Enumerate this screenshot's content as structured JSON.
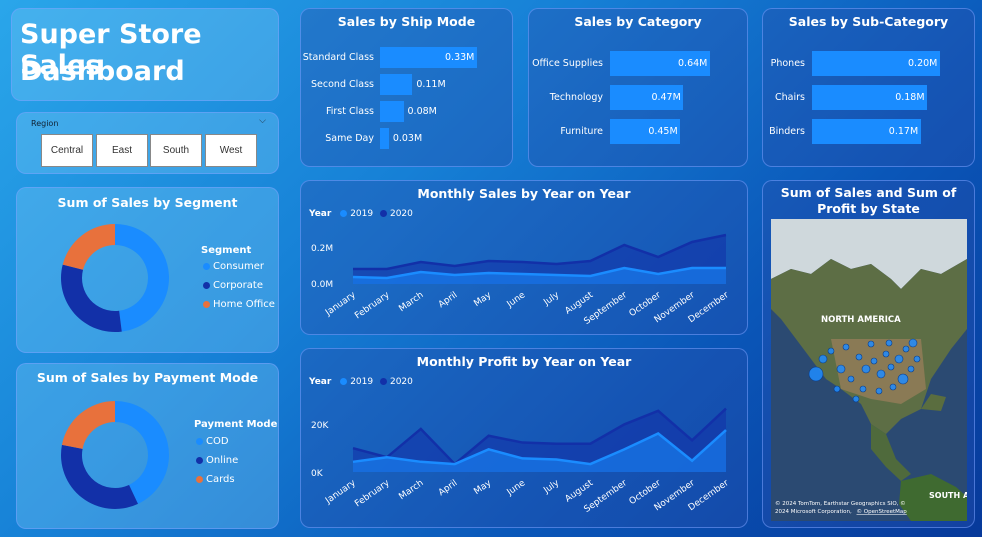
{
  "title": {
    "line1": "Super Store Sales",
    "line2": "Dashboard"
  },
  "region_slicer": {
    "label": "Region",
    "options": [
      "Central",
      "East",
      "South",
      "West"
    ]
  },
  "ship_mode": {
    "title": "Sales by Ship Mode",
    "items": [
      {
        "label": "Standard Class",
        "value": 0.33,
        "display": "0.33M"
      },
      {
        "label": "Second Class",
        "value": 0.11,
        "display": "0.11M"
      },
      {
        "label": "First Class",
        "value": 0.08,
        "display": "0.08M"
      },
      {
        "label": "Same Day",
        "value": 0.03,
        "display": "0.03M"
      }
    ]
  },
  "category": {
    "title": "Sales by Category",
    "items": [
      {
        "label": "Office Supplies",
        "value": 0.64,
        "display": "0.64M"
      },
      {
        "label": "Technology",
        "value": 0.47,
        "display": "0.47M"
      },
      {
        "label": "Furniture",
        "value": 0.45,
        "display": "0.45M"
      }
    ]
  },
  "sub_category": {
    "title": "Sales by Sub-Category",
    "items": [
      {
        "label": "Phones",
        "value": 0.2,
        "display": "0.20M"
      },
      {
        "label": "Chairs",
        "value": 0.18,
        "display": "0.18M"
      },
      {
        "label": "Binders",
        "value": 0.17,
        "display": "0.17M"
      }
    ]
  },
  "segment": {
    "title": "Sum of Sales by Segment",
    "legend_title": "Segment",
    "items": [
      {
        "label": "Consumer",
        "value": 48,
        "color": "#1a8cff"
      },
      {
        "label": "Corporate",
        "value": 31,
        "color": "#1230a8"
      },
      {
        "label": "Home Office",
        "value": 21,
        "color": "#e8713c"
      }
    ]
  },
  "payment": {
    "title": "Sum of Sales by Payment Mode",
    "legend_title": "Payment Mode",
    "items": [
      {
        "label": "COD",
        "value": 43,
        "color": "#1a8cff"
      },
      {
        "label": "Online",
        "value": 35,
        "color": "#1230a8"
      },
      {
        "label": "Cards",
        "value": 22,
        "color": "#e8713c"
      }
    ]
  },
  "monthly_sales": {
    "title": "Monthly Sales by Year on Year",
    "legend_title": "Year",
    "series_labels": [
      "2019",
      "2020"
    ],
    "y_ticks": [
      "0.2M",
      "0.0M"
    ]
  },
  "monthly_profit": {
    "title": "Monthly Profit by Year on Year",
    "legend_title": "Year",
    "series_labels": [
      "2019",
      "2020"
    ],
    "y_ticks": [
      "20K",
      "0K"
    ]
  },
  "months": [
    "January",
    "February",
    "March",
    "April",
    "May",
    "June",
    "July",
    "August",
    "September",
    "October",
    "November",
    "December"
  ],
  "map": {
    "title": "Sum of Sales and Sum of Profit by State",
    "label_na": "NORTH AMERICA",
    "label_sa": "SOUTH A",
    "attribution1": "© 2024 TomTom, Earthstar Geographics SIO, ©",
    "attribution2": "2024 Microsoft Corporation,",
    "attribution_link": "© OpenStreetMap"
  },
  "chart_data": [
    {
      "type": "area",
      "title": "Monthly Sales by Year on Year",
      "categories": [
        "January",
        "February",
        "March",
        "April",
        "May",
        "June",
        "July",
        "August",
        "September",
        "October",
        "November",
        "December"
      ],
      "ylim": [
        0,
        0.25
      ],
      "series": [
        {
          "name": "2019",
          "values": [
            0.035,
            0.03,
            0.06,
            0.045,
            0.055,
            0.05,
            0.045,
            0.04,
            0.08,
            0.05,
            0.08,
            0.08
          ]
        },
        {
          "name": "2020",
          "values": [
            0.075,
            0.075,
            0.11,
            0.09,
            0.115,
            0.11,
            0.1,
            0.115,
            0.195,
            0.135,
            0.21,
            0.245
          ]
        }
      ]
    },
    {
      "type": "area",
      "title": "Monthly Profit by Year on Year",
      "categories": [
        "January",
        "February",
        "March",
        "April",
        "May",
        "June",
        "July",
        "August",
        "September",
        "October",
        "November",
        "December"
      ],
      "ylim": [
        0,
        34000
      ],
      "series": [
        {
          "name": "2019",
          "values": [
            4500,
            6500,
            4500,
            3500,
            10000,
            6000,
            5500,
            3500,
            10000,
            17000,
            5000,
            18500
          ]
        },
        {
          "name": "2020",
          "values": [
            10500,
            6500,
            19000,
            3500,
            16000,
            13000,
            12500,
            12500,
            21000,
            27000,
            14000,
            28000
          ]
        }
      ]
    },
    {
      "type": "pie",
      "title": "Sum of Sales by Segment",
      "categories": [
        "Consumer",
        "Corporate",
        "Home Office"
      ],
      "values": [
        48,
        31,
        21
      ]
    },
    {
      "type": "pie",
      "title": "Sum of Sales by Payment Mode",
      "categories": [
        "COD",
        "Online",
        "Cards"
      ],
      "values": [
        43,
        35,
        22
      ]
    },
    {
      "type": "bar",
      "title": "Sales by Ship Mode",
      "categories": [
        "Standard Class",
        "Second Class",
        "First Class",
        "Same Day"
      ],
      "values": [
        0.33,
        0.11,
        0.08,
        0.03
      ]
    },
    {
      "type": "bar",
      "title": "Sales by Category",
      "categories": [
        "Office Supplies",
        "Technology",
        "Furniture"
      ],
      "values": [
        0.64,
        0.47,
        0.45
      ]
    },
    {
      "type": "bar",
      "title": "Sales by Sub-Category",
      "categories": [
        "Phones",
        "Chairs",
        "Binders"
      ],
      "values": [
        0.2,
        0.18,
        0.17
      ]
    }
  ]
}
